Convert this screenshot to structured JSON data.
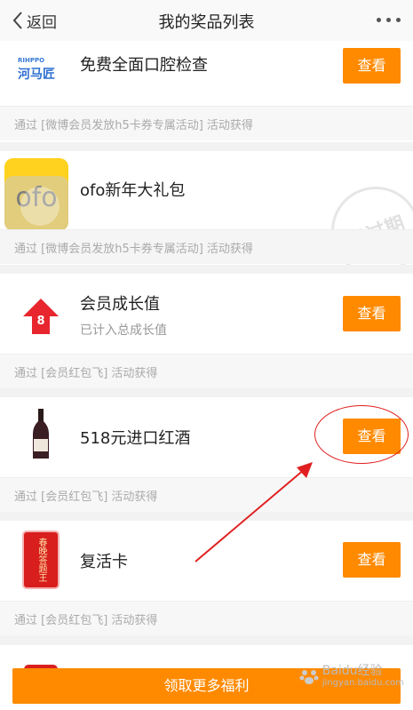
{
  "header": {
    "back_label": "返回",
    "title": "我的奖品列表"
  },
  "prizes": [
    {
      "icon": "brand-logo-icon",
      "title": "免费全面口腔检查",
      "subtitle": "",
      "button": "查看",
      "source": "通过 [微博会员发放h5卡券专属活动] 活动获得",
      "expired": false
    },
    {
      "icon": "ofo-logo-icon",
      "title": "ofo新年大礼包",
      "subtitle": "",
      "button": "",
      "source": "通过 [微博会员发放h5卡券专属活动] 活动获得",
      "expired": true,
      "stamp": "已过期"
    },
    {
      "icon": "growth-arrow-icon",
      "badge": "8",
      "title": "会员成长值",
      "subtitle": "已计入总成长值",
      "button": "查看",
      "source": "通过 [会员红包飞] 活动获得",
      "expired": false
    },
    {
      "icon": "wine-bottle-icon",
      "title": "518元进口红酒",
      "subtitle": "",
      "button": "查看",
      "source": "通过 [会员红包飞] 活动获得",
      "expired": false
    },
    {
      "icon": "revive-card-icon",
      "icon_text": "春晚答题王",
      "title": "复活卡",
      "subtitle": "",
      "button": "查看",
      "source": "通过 [会员红包飞] 活动获得",
      "expired": false
    }
  ],
  "footer": {
    "button": "领取更多福利"
  },
  "watermark": {
    "brand": "Baidu经验",
    "url": "jingyan.baidu.com"
  },
  "colors": {
    "accent": "#ff8a00",
    "annotation": "#e02020"
  }
}
